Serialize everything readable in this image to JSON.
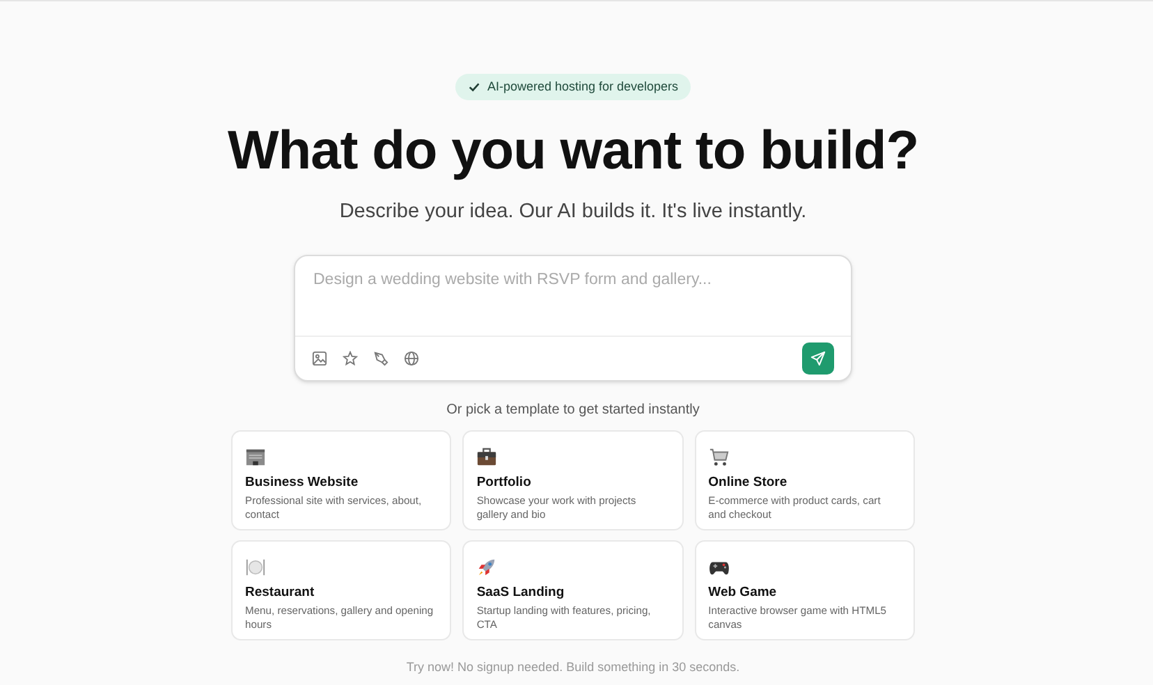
{
  "badge": {
    "text": "AI-powered hosting for developers"
  },
  "heading": "What do you want to build?",
  "subtitle": "Describe your idea. Our AI builds it. It's live instantly.",
  "prompt": {
    "placeholder": "Design a wedding website with RSVP form and gallery..."
  },
  "templates_intro": "Or pick a template to get started instantly",
  "templates": [
    {
      "title": "Business Website",
      "description": "Professional site with services, about, contact"
    },
    {
      "title": "Portfolio",
      "description": "Showcase your work with projects gallery and bio"
    },
    {
      "title": "Online Store",
      "description": "E-commerce with product cards, cart and checkout"
    },
    {
      "title": "Restaurant",
      "description": "Menu, reservations, gallery and opening hours"
    },
    {
      "title": "SaaS Landing",
      "description": "Startup landing with features, pricing, CTA"
    },
    {
      "title": "Web Game",
      "description": "Interactive browser game with HTML5 canvas"
    }
  ],
  "footer": "Try now! No signup needed. Build something in 30 seconds."
}
